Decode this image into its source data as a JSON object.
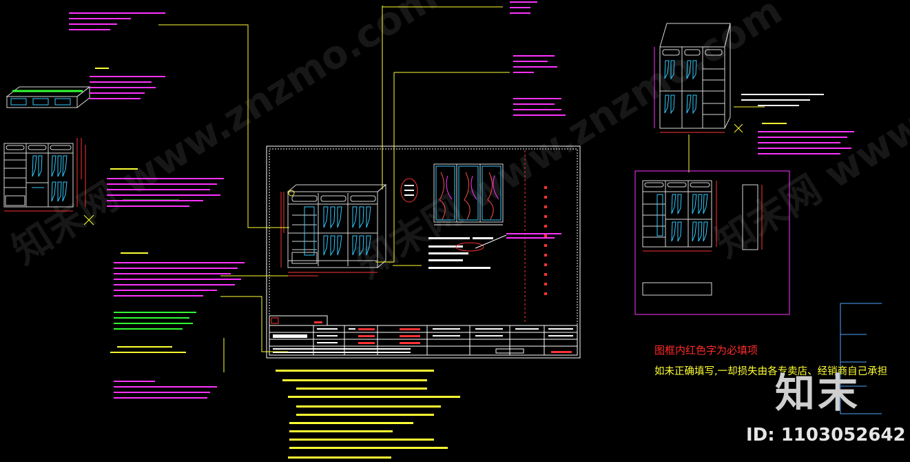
{
  "notices": {
    "line1": "图框内红色字为必填项",
    "line2": "如未正确填写,一却损失由各专卖店、经销商自己承担"
  },
  "branding": {
    "site": "知末",
    "id_label": "ID: 1103052642"
  },
  "colors": {
    "background": "#000000",
    "frame": "#ffffff",
    "cabinet": "#d9d9d9",
    "annotation": "#ff33ff",
    "leader": "#ffff33",
    "dimension": "#ff3333",
    "cyan": "#33ccff",
    "green": "#33ff33",
    "blue_frame": "#4da6ff"
  }
}
